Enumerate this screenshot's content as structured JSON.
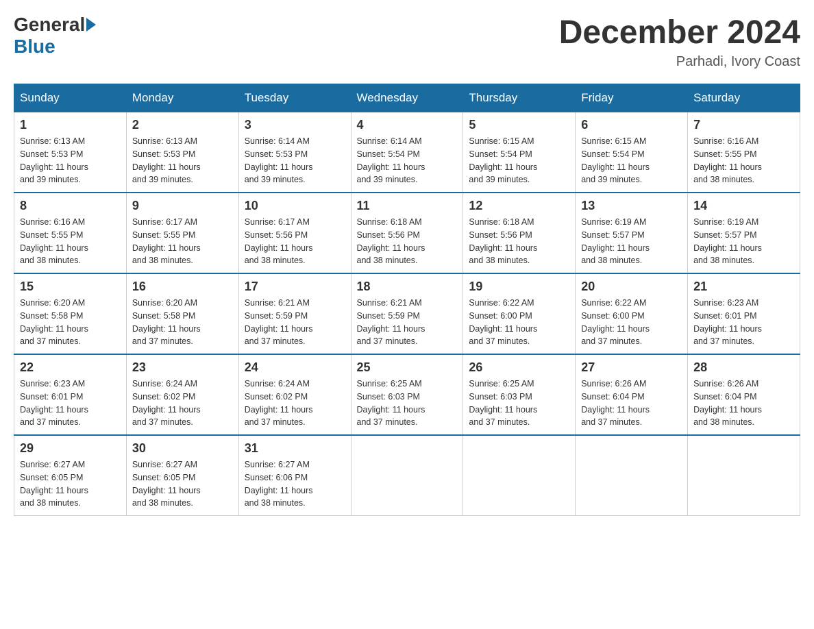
{
  "logo": {
    "general": "General",
    "blue": "Blue"
  },
  "title": "December 2024",
  "location": "Parhadi, Ivory Coast",
  "days_of_week": [
    "Sunday",
    "Monday",
    "Tuesday",
    "Wednesday",
    "Thursday",
    "Friday",
    "Saturday"
  ],
  "weeks": [
    [
      {
        "day": "1",
        "sunrise": "6:13 AM",
        "sunset": "5:53 PM",
        "daylight": "11 hours and 39 minutes."
      },
      {
        "day": "2",
        "sunrise": "6:13 AM",
        "sunset": "5:53 PM",
        "daylight": "11 hours and 39 minutes."
      },
      {
        "day": "3",
        "sunrise": "6:14 AM",
        "sunset": "5:53 PM",
        "daylight": "11 hours and 39 minutes."
      },
      {
        "day": "4",
        "sunrise": "6:14 AM",
        "sunset": "5:54 PM",
        "daylight": "11 hours and 39 minutes."
      },
      {
        "day": "5",
        "sunrise": "6:15 AM",
        "sunset": "5:54 PM",
        "daylight": "11 hours and 39 minutes."
      },
      {
        "day": "6",
        "sunrise": "6:15 AM",
        "sunset": "5:54 PM",
        "daylight": "11 hours and 39 minutes."
      },
      {
        "day": "7",
        "sunrise": "6:16 AM",
        "sunset": "5:55 PM",
        "daylight": "11 hours and 38 minutes."
      }
    ],
    [
      {
        "day": "8",
        "sunrise": "6:16 AM",
        "sunset": "5:55 PM",
        "daylight": "11 hours and 38 minutes."
      },
      {
        "day": "9",
        "sunrise": "6:17 AM",
        "sunset": "5:55 PM",
        "daylight": "11 hours and 38 minutes."
      },
      {
        "day": "10",
        "sunrise": "6:17 AM",
        "sunset": "5:56 PM",
        "daylight": "11 hours and 38 minutes."
      },
      {
        "day": "11",
        "sunrise": "6:18 AM",
        "sunset": "5:56 PM",
        "daylight": "11 hours and 38 minutes."
      },
      {
        "day": "12",
        "sunrise": "6:18 AM",
        "sunset": "5:56 PM",
        "daylight": "11 hours and 38 minutes."
      },
      {
        "day": "13",
        "sunrise": "6:19 AM",
        "sunset": "5:57 PM",
        "daylight": "11 hours and 38 minutes."
      },
      {
        "day": "14",
        "sunrise": "6:19 AM",
        "sunset": "5:57 PM",
        "daylight": "11 hours and 38 minutes."
      }
    ],
    [
      {
        "day": "15",
        "sunrise": "6:20 AM",
        "sunset": "5:58 PM",
        "daylight": "11 hours and 37 minutes."
      },
      {
        "day": "16",
        "sunrise": "6:20 AM",
        "sunset": "5:58 PM",
        "daylight": "11 hours and 37 minutes."
      },
      {
        "day": "17",
        "sunrise": "6:21 AM",
        "sunset": "5:59 PM",
        "daylight": "11 hours and 37 minutes."
      },
      {
        "day": "18",
        "sunrise": "6:21 AM",
        "sunset": "5:59 PM",
        "daylight": "11 hours and 37 minutes."
      },
      {
        "day": "19",
        "sunrise": "6:22 AM",
        "sunset": "6:00 PM",
        "daylight": "11 hours and 37 minutes."
      },
      {
        "day": "20",
        "sunrise": "6:22 AM",
        "sunset": "6:00 PM",
        "daylight": "11 hours and 37 minutes."
      },
      {
        "day": "21",
        "sunrise": "6:23 AM",
        "sunset": "6:01 PM",
        "daylight": "11 hours and 37 minutes."
      }
    ],
    [
      {
        "day": "22",
        "sunrise": "6:23 AM",
        "sunset": "6:01 PM",
        "daylight": "11 hours and 37 minutes."
      },
      {
        "day": "23",
        "sunrise": "6:24 AM",
        "sunset": "6:02 PM",
        "daylight": "11 hours and 37 minutes."
      },
      {
        "day": "24",
        "sunrise": "6:24 AM",
        "sunset": "6:02 PM",
        "daylight": "11 hours and 37 minutes."
      },
      {
        "day": "25",
        "sunrise": "6:25 AM",
        "sunset": "6:03 PM",
        "daylight": "11 hours and 37 minutes."
      },
      {
        "day": "26",
        "sunrise": "6:25 AM",
        "sunset": "6:03 PM",
        "daylight": "11 hours and 37 minutes."
      },
      {
        "day": "27",
        "sunrise": "6:26 AM",
        "sunset": "6:04 PM",
        "daylight": "11 hours and 37 minutes."
      },
      {
        "day": "28",
        "sunrise": "6:26 AM",
        "sunset": "6:04 PM",
        "daylight": "11 hours and 38 minutes."
      }
    ],
    [
      {
        "day": "29",
        "sunrise": "6:27 AM",
        "sunset": "6:05 PM",
        "daylight": "11 hours and 38 minutes."
      },
      {
        "day": "30",
        "sunrise": "6:27 AM",
        "sunset": "6:05 PM",
        "daylight": "11 hours and 38 minutes."
      },
      {
        "day": "31",
        "sunrise": "6:27 AM",
        "sunset": "6:06 PM",
        "daylight": "11 hours and 38 minutes."
      },
      null,
      null,
      null,
      null
    ]
  ]
}
